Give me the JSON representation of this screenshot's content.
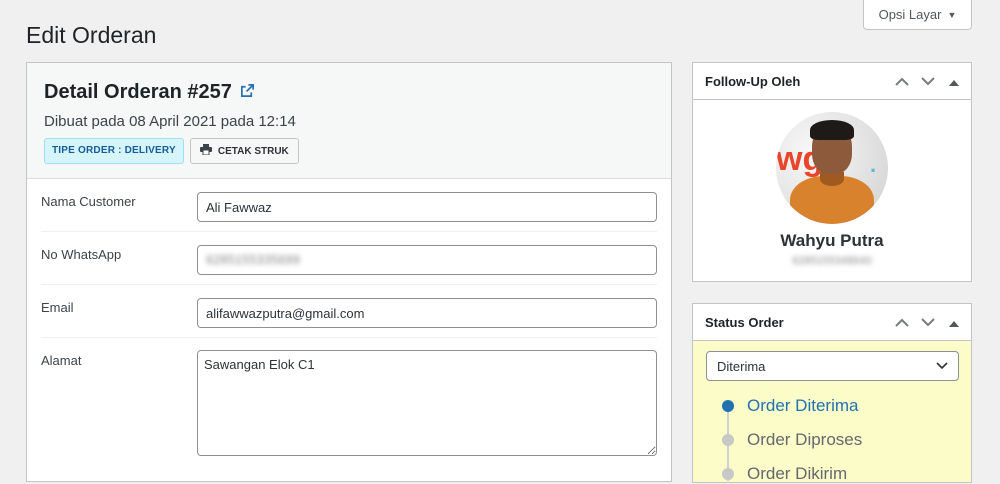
{
  "screen_options": {
    "label": "Opsi Layar"
  },
  "page_title": "Edit Orderan",
  "order": {
    "title": "Detail Orderan #257",
    "created": "Dibuat pada 08 April 2021 pada 12:14",
    "type_badge": "TIPE ORDER : DELIVERY",
    "print_label": "CETAK STRUK"
  },
  "fields": {
    "customer_label": "Nama Customer",
    "customer_value": "Ali Fawwaz",
    "whatsapp_label": "No WhatsApp",
    "whatsapp_value": "6285155335699",
    "email_label": "Email",
    "email_value": "alifawwazputra@gmail.com",
    "address_label": "Alamat",
    "address_value": "Sawangan Elok C1"
  },
  "followup": {
    "title": "Follow-Up Oleh",
    "name": "Wahyu Putra",
    "phone": "6285155348640"
  },
  "status": {
    "title": "Status Order",
    "selected": "Diterima",
    "steps": [
      {
        "label": "Order Diterima",
        "active": true
      },
      {
        "label": "Order Diproses",
        "active": false
      },
      {
        "label": "Order Dikirim",
        "active": false
      }
    ]
  },
  "colors": {
    "accent": "#2271b1",
    "status_bg": "#fbfcc8",
    "inactive": "#646970"
  }
}
